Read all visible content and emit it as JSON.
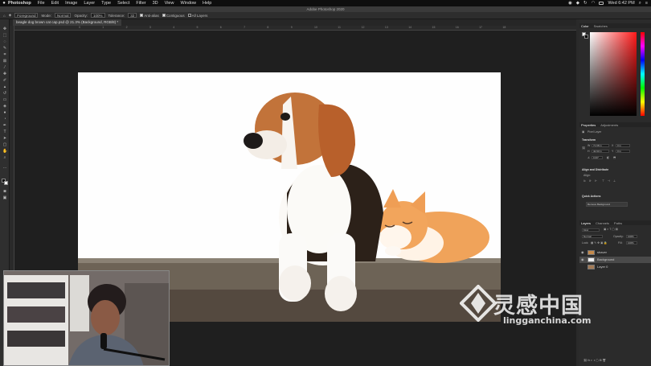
{
  "menubar": {
    "app": "Photoshop",
    "items": [
      "File",
      "Edit",
      "Image",
      "Layer",
      "Type",
      "Select",
      "Filter",
      "3D",
      "View",
      "Window",
      "Help"
    ],
    "clock": "Wed 6:42 PM"
  },
  "window": {
    "title": "Adobe Photoshop 2020"
  },
  "options": {
    "sample": "Foreground",
    "mode_label": "Mode:",
    "mode_value": "Normal",
    "opacity_label": "Opacity:",
    "opacity_value": "100%",
    "tolerance_label": "Tolerance:",
    "tolerance_value": "32",
    "anti_alias": "Anti-alias",
    "contiguous": "Contiguous",
    "all_layers": "All Layers"
  },
  "document": {
    "tab_label": "beagle dog brown cat cap.psd @ 21.3% (Background, RGB/8) *"
  },
  "ruler": {
    "top_ticks": [
      "0",
      "1",
      "2",
      "3",
      "4",
      "5",
      "6",
      "7",
      "8",
      "9",
      "10",
      "11",
      "12",
      "13",
      "14",
      "15",
      "16",
      "17",
      "18"
    ]
  },
  "panels": {
    "color_tabs": [
      "Color",
      "Swatches"
    ],
    "properties_tabs": [
      "Properties",
      "Adjustments"
    ],
    "layer_kind": "Pixel Layer",
    "transform_label": "Transform",
    "w_label": "W",
    "w_value": "71.68 in",
    "x_label": "X",
    "x_value": "0 in",
    "h_label": "H",
    "h_value": "42.93 in",
    "y_label": "Y",
    "y_value": "0 in",
    "angle_value": "0.00°",
    "align_label": "Align and Distribute",
    "align_sub": "Align:",
    "quick_actions_label": "Quick Actions",
    "remove_bg_button": "Remove Background",
    "layers_tabs": [
      "Layers",
      "Channels",
      "Paths"
    ],
    "kind_filter": "Kind",
    "blend_mode": "Normal",
    "opacity_label": "Opacity:",
    "opacity_value": "100%",
    "lock_label": "Lock:",
    "fill_label": "Fill:",
    "fill_value": "100%",
    "layers": [
      {
        "name": "shaver"
      },
      {
        "name": "Background"
      },
      {
        "name": "Layer 0"
      }
    ]
  },
  "watermark": {
    "text_cn": "灵感中国",
    "text_en": "lingganchina.com"
  },
  "colors": {
    "app_bg": "#1e1e1e",
    "panel_bg": "#2b2b2b",
    "selected_layer": "#4a4a4a",
    "accent_red": "#ff1a1a"
  }
}
